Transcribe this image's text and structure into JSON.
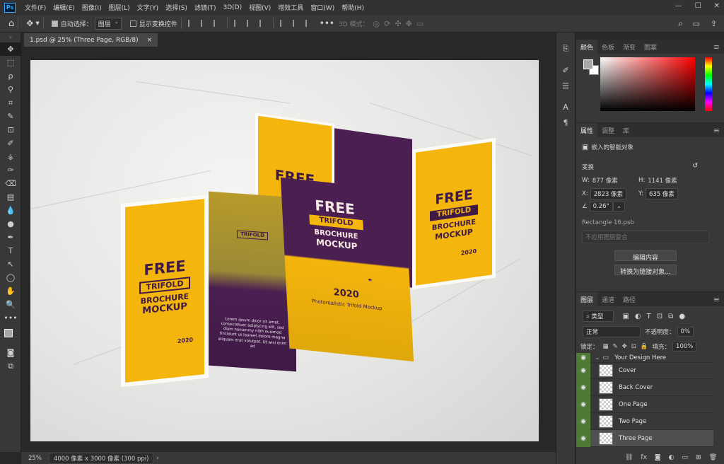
{
  "app": {
    "logo": "Ps"
  },
  "menus": [
    "文件(F)",
    "编辑(E)",
    "图像(I)",
    "图层(L)",
    "文字(Y)",
    "选择(S)",
    "滤镜(T)",
    "3D(D)",
    "视图(V)",
    "增效工具",
    "窗口(W)",
    "帮助(H)"
  ],
  "window_controls": {
    "minimize": "—",
    "maximize": "☐",
    "close": "✕"
  },
  "options": {
    "auto_select_label": "自动选择：",
    "auto_select_value": "图层",
    "transform_label": "显示变换控件",
    "mode_3d": "3D 模式："
  },
  "doc_tab": {
    "title": "1.psd @ 25% (Three Page, RGB/8)",
    "close": "×"
  },
  "status": {
    "zoom": "25%",
    "doc_info": "4000 像素 x 3000 像素 (300 ppi)",
    "arrow": "›"
  },
  "color_panel": {
    "tabs": [
      "颜色",
      "色板",
      "渐变",
      "图案"
    ],
    "fg_color": "#a8a8a8",
    "bg_color": "#ffffff"
  },
  "properties": {
    "tabs": [
      "属性",
      "调整",
      "库"
    ],
    "type": "嵌入的智能对象",
    "section": "变换",
    "w_label": "W:",
    "w_value": "877 像素",
    "h_label": "H:",
    "h_value": "1141 像素",
    "x_label": "X:",
    "x_value": "2823 像素",
    "y_label": "Y:",
    "y_value": "635 像素",
    "angle_value": "0.26°",
    "source": "Rectangle 16.psb",
    "comp_placeholder": "不应用图层复合",
    "edit_btn": "编辑内容",
    "convert_btn": "转换为链接对象..."
  },
  "layers": {
    "tabs": [
      "图层",
      "通道",
      "路径"
    ],
    "filter_kind": "类型",
    "blend_mode": "正常",
    "opacity_label": "不透明度：",
    "opacity_value": "0%",
    "lock_label": "锁定：",
    "fill_label": "填充：",
    "fill_value": "100%",
    "group_name": "Your Design Here",
    "items": [
      {
        "name": "Cover"
      },
      {
        "name": "Back Cover"
      },
      {
        "name": "One Page"
      },
      {
        "name": "Two Page"
      },
      {
        "name": "Three Page"
      }
    ]
  },
  "brochure": {
    "free": "FREE",
    "trifold": "TRIFOLD",
    "brochure": "BROCHURE",
    "mockup": "MOCKUP",
    "year": "2020",
    "quote": "❞",
    "subtitle": "Photorealistic Trifold Mockup",
    "lorem": "Lorem ipsum dolor sit amet, consectetuer adipiscing elit, sed diam nonummy nibh euismod tincidunt ut laoreet dolore magna aliquam erat volutpat. Ut wisi enim ad",
    "small_caption": "Photorealistic Trifold Mockup"
  },
  "colors": {
    "yellow": "#f4b50c",
    "purple": "#4b1f52",
    "accent": "#31a8ff",
    "layer_eye": "#4f7a35"
  }
}
